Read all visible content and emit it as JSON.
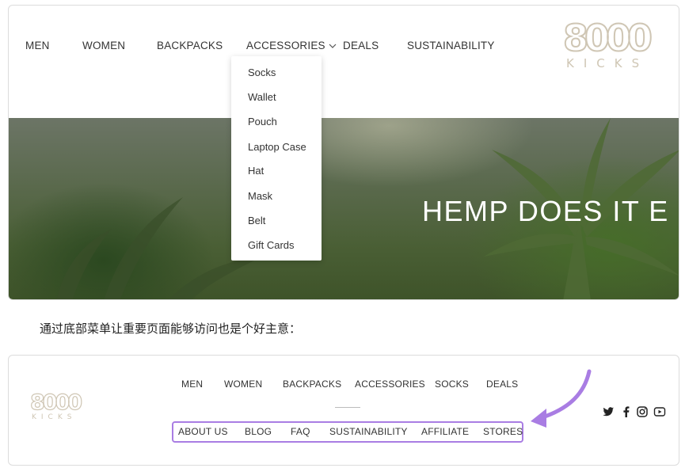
{
  "header_nav": {
    "men": "MEN",
    "women": "WOMEN",
    "backpacks": "BACKPACKS",
    "accessories": "ACCESSORIES",
    "deals": "DEALS",
    "sustainability": "SUSTAINABILITY"
  },
  "logo": {
    "number": "8000",
    "word": "KICKS"
  },
  "accessories_menu": [
    "Socks",
    "Wallet",
    "Pouch",
    "Laptop Case",
    "Hat",
    "Mask",
    "Belt",
    "Gift Cards"
  ],
  "hero": {
    "title": "HEMP DOES IT E"
  },
  "caption": "通过底部菜单让重要页面能够访问也是个好主意：",
  "footer_nav": {
    "main": [
      "MEN",
      "WOMEN",
      "BACKPACKS",
      "ACCESSORIES",
      "SOCKS",
      "DEALS"
    ],
    "secondary": [
      "ABOUT US",
      "BLOG",
      "FAQ",
      "SUSTAINABILITY",
      "AFFILIATE",
      "STORES"
    ]
  },
  "social_icons": [
    "twitter-icon",
    "facebook-icon",
    "instagram-icon",
    "youtube-icon"
  ],
  "colors": {
    "highlight": "#a97de3",
    "logo": "#cfc6b4",
    "arrow": "#a97de3"
  }
}
